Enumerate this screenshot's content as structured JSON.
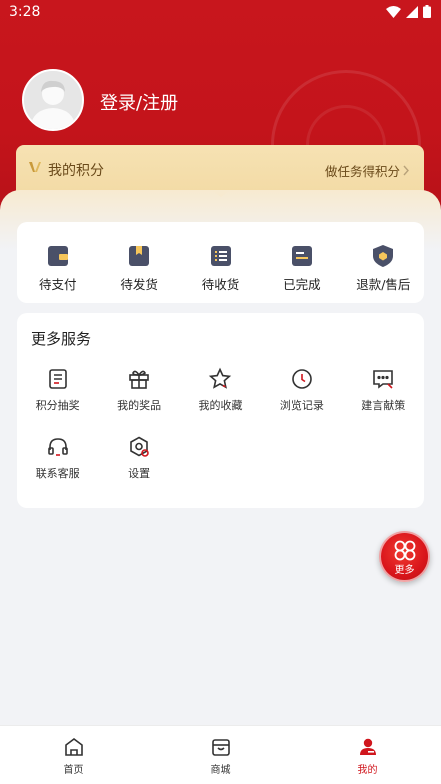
{
  "status_bar": {
    "time": "3:28"
  },
  "profile": {
    "login_label": "登录/注册"
  },
  "points": {
    "label": "我的积分",
    "action": "做任务得积分"
  },
  "orders": [
    {
      "label": "待支付",
      "icon": "wallet-icon"
    },
    {
      "label": "待发货",
      "icon": "package-icon"
    },
    {
      "label": "待收货",
      "icon": "list-icon"
    },
    {
      "label": "已完成",
      "icon": "completed-icon"
    },
    {
      "label": "退款/售后",
      "icon": "shield-icon"
    }
  ],
  "services": {
    "title": "更多服务",
    "items": [
      {
        "label": "积分抽奖",
        "icon": "lottery-icon"
      },
      {
        "label": "我的奖品",
        "icon": "gift-icon"
      },
      {
        "label": "我的收藏",
        "icon": "star-icon"
      },
      {
        "label": "浏览记录",
        "icon": "clock-icon"
      },
      {
        "label": "建言献策",
        "icon": "chat-icon"
      },
      {
        "label": "联系客服",
        "icon": "headset-icon"
      },
      {
        "label": "设置",
        "icon": "settings-icon"
      }
    ]
  },
  "fab": {
    "label": "更多"
  },
  "tabs": [
    {
      "label": "首页",
      "icon": "home-icon"
    },
    {
      "label": "商城",
      "icon": "store-icon"
    },
    {
      "label": "我的",
      "icon": "user-icon",
      "active": true
    }
  ],
  "colors": {
    "brand": "#c8161d",
    "gold": "#f5deae",
    "icon_dark": "#4a5068"
  }
}
